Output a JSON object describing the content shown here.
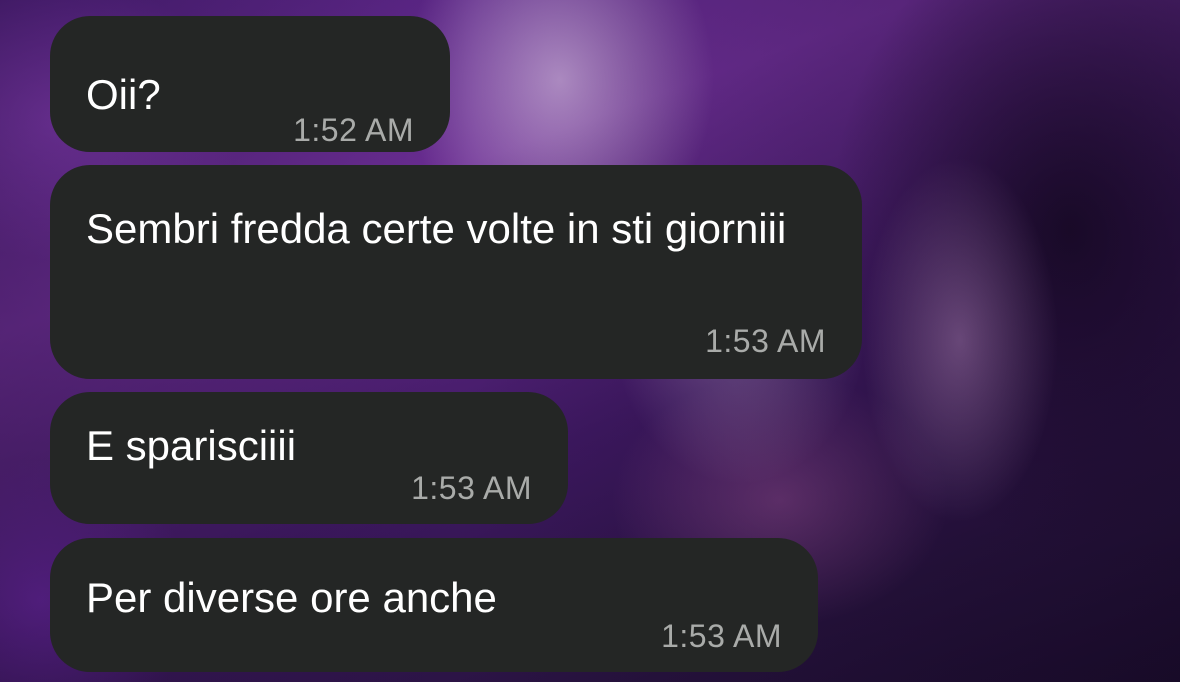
{
  "chat": {
    "messages": [
      {
        "text": "Oii?",
        "time": "1:52 AM"
      },
      {
        "text": "Sembri fredda certe volte in sti giorniii",
        "time": "1:53 AM"
      },
      {
        "text": "E sparisciiii",
        "time": "1:53 AM"
      },
      {
        "text": "Per diverse ore anche",
        "time": "1:53 AM"
      }
    ]
  },
  "colors": {
    "bubble_background": "#242625",
    "message_text": "#ffffff",
    "timestamp_text": "#a9aba9"
  }
}
